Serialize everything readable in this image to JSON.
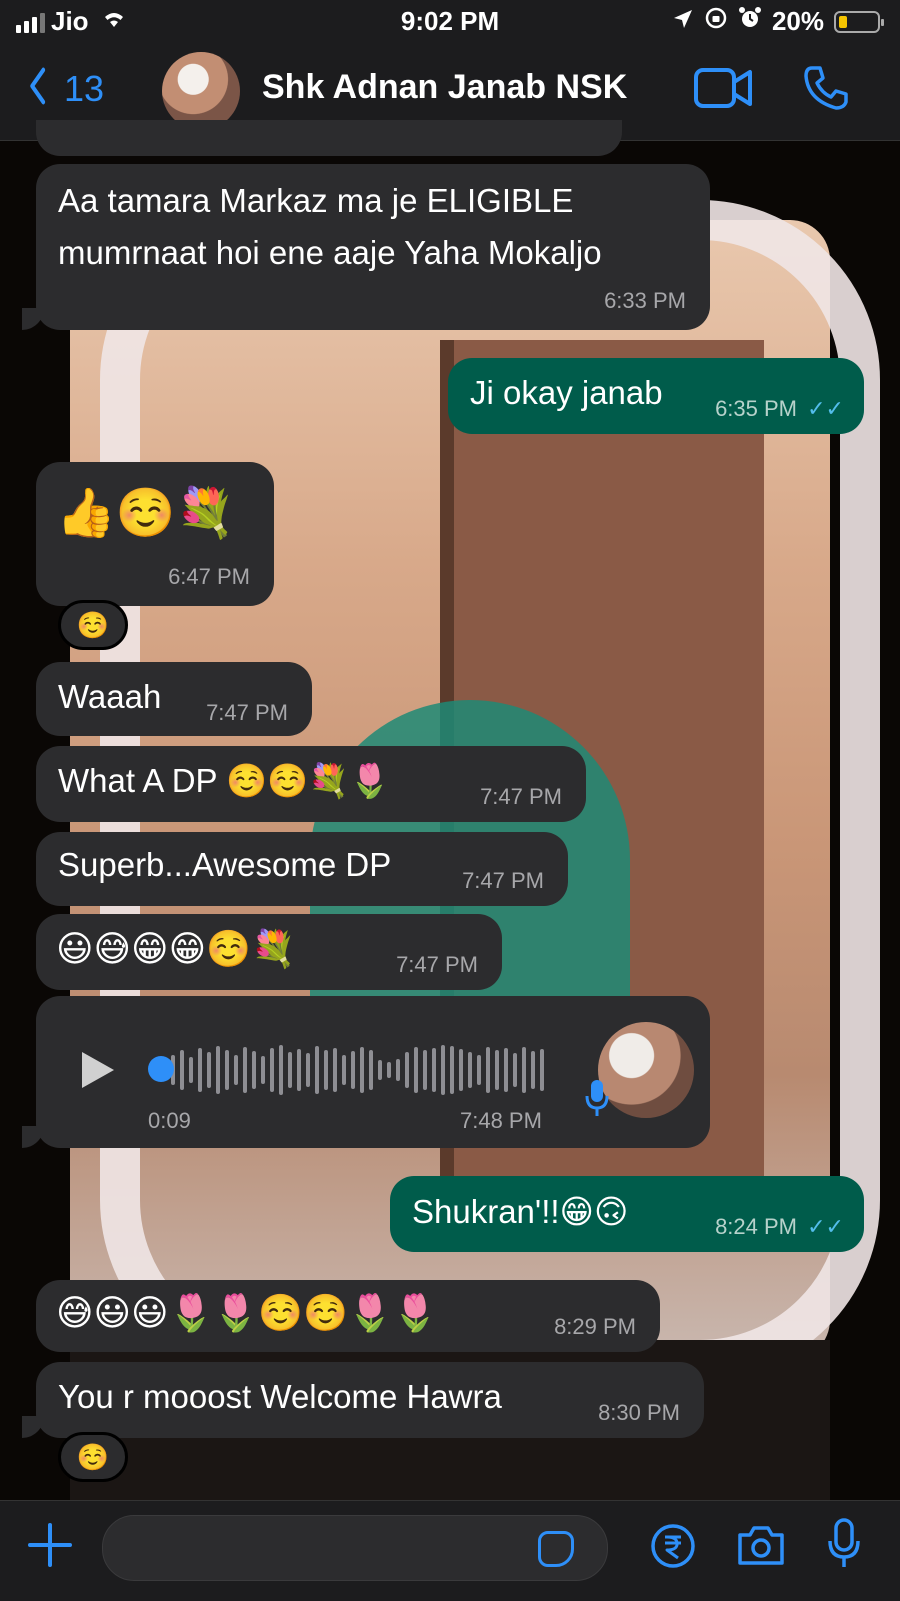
{
  "status_bar": {
    "carrier": "Jio",
    "time": "9:02 PM",
    "battery": "20%",
    "battery_level": 0.2
  },
  "header": {
    "back_count": "13",
    "contact_name": "Shk Adnan Janab NSK",
    "icons": [
      "chevron-left-icon",
      "video-call-icon",
      "phone-icon"
    ]
  },
  "messages": [
    {
      "dir": "in",
      "line1": "Aa tamara Markaz ma je ELIGIBLE",
      "line2": "mumrnaat hoi ene aaje Yaha Mokaljo",
      "time": "6:33 PM"
    },
    {
      "dir": "out",
      "text": "Ji okay janab",
      "time": "6:35 PM",
      "status": "read"
    },
    {
      "dir": "in",
      "text": "👍☺️💐",
      "time": "6:47 PM",
      "reaction": "☺️"
    },
    {
      "dir": "in",
      "text": "Waaah",
      "time": "7:47 PM"
    },
    {
      "dir": "in",
      "text": "What A DP ☺️☺️💐🌷",
      "time": "7:47 PM"
    },
    {
      "dir": "in",
      "text": "Superb...Awesome DP",
      "time": "7:47 PM"
    },
    {
      "dir": "in",
      "text": "😃😅😁😁☺️💐",
      "time": "7:47 PM"
    },
    {
      "dir": "in",
      "type": "voice",
      "duration": "0:09",
      "time": "7:48 PM",
      "progress": 0
    },
    {
      "dir": "out",
      "text": "Shukran'!!😁🙃",
      "time": "8:24 PM",
      "status": "read"
    },
    {
      "dir": "in",
      "text": "😅😃😃🌷🌷☺️☺️🌷🌷",
      "time": "8:29 PM"
    },
    {
      "dir": "in",
      "text": "You r mooost Welcome Hawra",
      "time": "8:30 PM",
      "reaction": "☺️"
    }
  ],
  "composer": {
    "icons": [
      "plus-icon",
      "sticker-icon",
      "rupee-payment-icon",
      "camera-icon",
      "microphone-icon"
    ]
  },
  "colors": {
    "accent": "#2e8ff8",
    "incoming_bubble": "#2c2c2e",
    "outgoing_bubble": "#005c4b",
    "read_tick": "#53bdeb"
  }
}
